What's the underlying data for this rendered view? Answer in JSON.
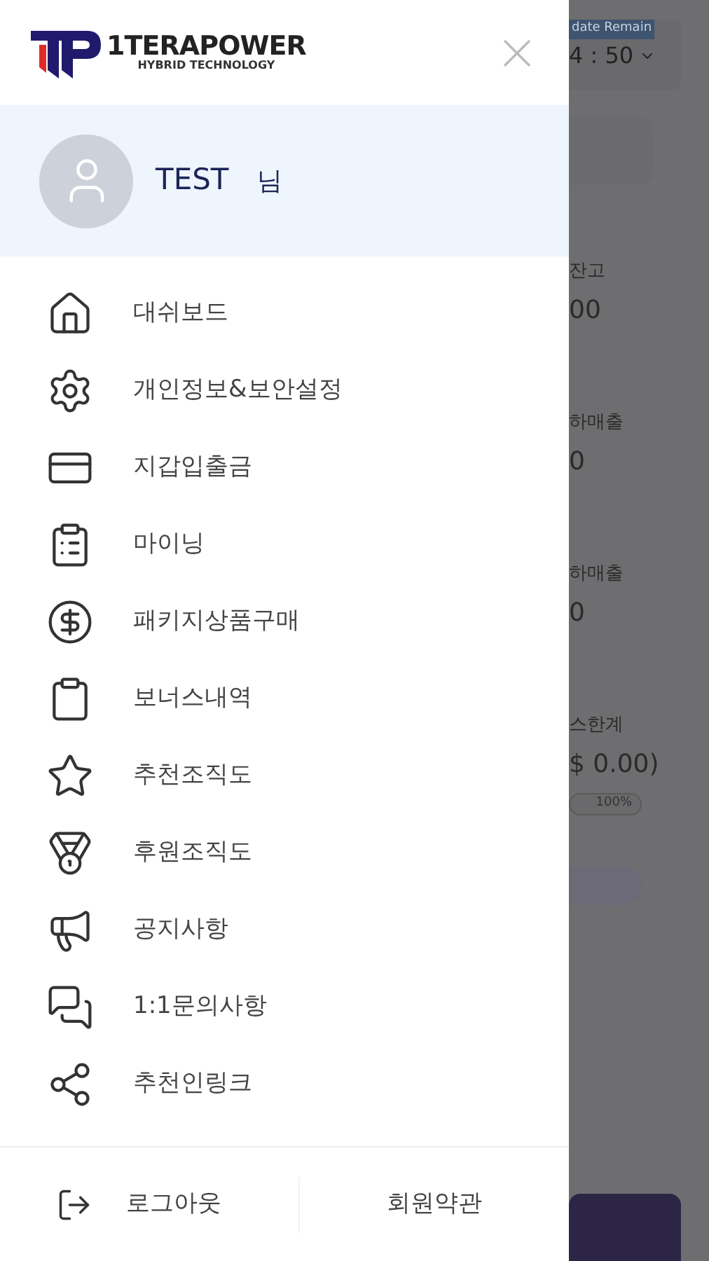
{
  "header": {
    "brand": "1TERAPOWER",
    "tagline": "HYBRID TECHNOLOGY"
  },
  "profile": {
    "name": "TEST",
    "suffix": "님"
  },
  "menu": [
    {
      "label": "대쉬보드"
    },
    {
      "label": "개인정보&보안설정"
    },
    {
      "label": "지갑입출금"
    },
    {
      "label": "마이닝"
    },
    {
      "label": "패키지상품구매"
    },
    {
      "label": "보너스내역"
    },
    {
      "label": "추천조직도"
    },
    {
      "label": "후원조직도"
    },
    {
      "label": "공지사항"
    },
    {
      "label": "1:1문의사항"
    },
    {
      "label": "추천인링크"
    }
  ],
  "footer": {
    "logout": "로그아웃",
    "terms": "회원약관"
  },
  "background": {
    "badge": "date Remain",
    "timer": "4 : 50",
    "stats": [
      {
        "label": "잔고",
        "value": "00"
      },
      {
        "label": "하매출",
        "value": "0"
      },
      {
        "label": "하매출",
        "value": "0"
      },
      {
        "label": "스한계",
        "value": "$ 0.00)"
      }
    ],
    "progress": {
      "level": 1,
      "reading": "100%"
    }
  }
}
